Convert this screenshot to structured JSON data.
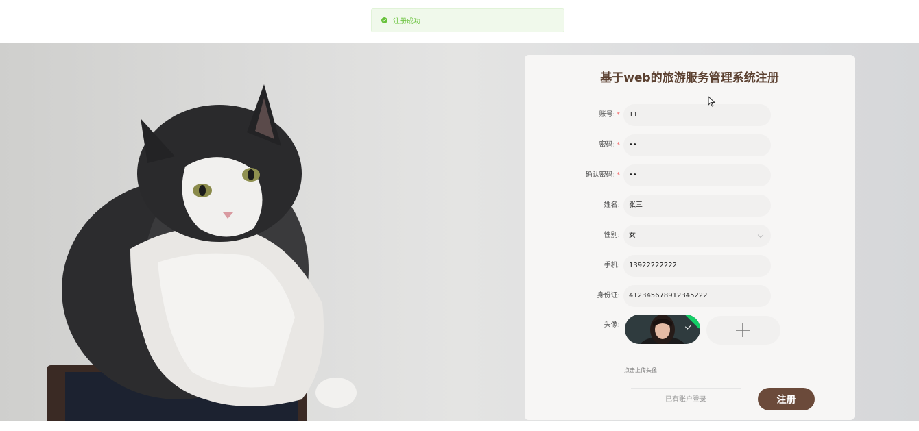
{
  "toast": {
    "message": "注册成功",
    "icon": "success-check-icon",
    "color": "#67c23a"
  },
  "form": {
    "title": "基于web的旅游服务管理系统注册",
    "fields": [
      {
        "label": "账号:",
        "required": true,
        "value": "11"
      },
      {
        "label": "密码:",
        "required": true,
        "value": "••"
      },
      {
        "label": "确认密码:",
        "required": true,
        "value": "••"
      },
      {
        "label": "姓名:",
        "required": false,
        "value": "张三"
      },
      {
        "label": "性别:",
        "required": false,
        "value": "女",
        "type": "select"
      },
      {
        "label": "手机:",
        "required": false,
        "value": "13922222222"
      },
      {
        "label": "身份证:",
        "required": false,
        "value": "412345678912345222"
      }
    ],
    "avatar_label": "头像:",
    "upload_hint": "点击上传头像",
    "login_link": "已有账户登录",
    "submit_label": "注册"
  },
  "colors": {
    "accent": "#6b4a3a",
    "title": "#5b4030",
    "required": "#f56c6c"
  }
}
